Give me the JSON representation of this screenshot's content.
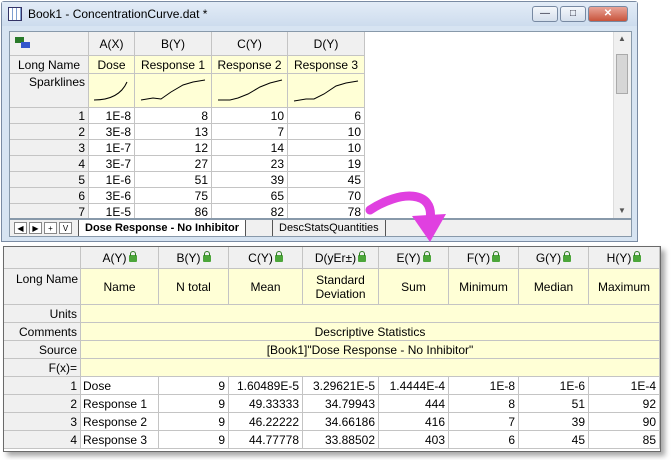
{
  "window": {
    "title": "Book1 - ConcentrationCurve.dat *",
    "min": "—",
    "max": "□",
    "close": "✕"
  },
  "sheet1": {
    "columns": [
      "A(X)",
      "B(Y)",
      "C(Y)",
      "D(Y)"
    ],
    "row_labels": {
      "long_name": "Long Name",
      "sparklines": "Sparklines"
    },
    "long_names": [
      "Dose",
      "Response 1",
      "Response 2",
      "Response 3"
    ],
    "rows": [
      {
        "n": "1",
        "cells": [
          "1E-8",
          "8",
          "10",
          "6"
        ]
      },
      {
        "n": "2",
        "cells": [
          "3E-8",
          "13",
          "7",
          "10"
        ]
      },
      {
        "n": "3",
        "cells": [
          "1E-7",
          "12",
          "14",
          "10"
        ]
      },
      {
        "n": "4",
        "cells": [
          "3E-7",
          "27",
          "23",
          "19"
        ]
      },
      {
        "n": "5",
        "cells": [
          "1E-6",
          "51",
          "39",
          "45"
        ]
      },
      {
        "n": "6",
        "cells": [
          "3E-6",
          "75",
          "65",
          "70"
        ]
      },
      {
        "n": "7",
        "cells": [
          "1E-5",
          "86",
          "82",
          "78"
        ]
      }
    ]
  },
  "tabs": {
    "nav": [
      "◀",
      "▶",
      "+",
      "V"
    ],
    "active": "Dose Response - No Inhibitor",
    "other": "DescStatsQuantities"
  },
  "sheet2": {
    "columns": [
      "A(Y)",
      "B(Y)",
      "C(Y)",
      "D(yEr±)",
      "E(Y)",
      "F(Y)",
      "G(Y)",
      "H(Y)"
    ],
    "row_labels": {
      "long_name": "Long Name",
      "units": "Units",
      "comments": "Comments",
      "source": "Source",
      "fx": "F(x)="
    },
    "long_names": [
      "Name",
      "N total",
      "Mean",
      "Standard Deviation",
      "Sum",
      "Minimum",
      "Median",
      "Maximum"
    ],
    "comments": "Descriptive Statistics",
    "source": "[Book1]\"Dose Response - No Inhibitor\"",
    "rows": [
      {
        "n": "1",
        "cells": [
          "Dose",
          "9",
          "1.60489E-5",
          "3.29621E-5",
          "1.4444E-4",
          "1E-8",
          "1E-6",
          "1E-4"
        ]
      },
      {
        "n": "2",
        "cells": [
          "Response 1",
          "9",
          "49.33333",
          "34.79943",
          "444",
          "8",
          "51",
          "92"
        ]
      },
      {
        "n": "3",
        "cells": [
          "Response 2",
          "9",
          "46.22222",
          "34.66186",
          "416",
          "7",
          "39",
          "90"
        ]
      },
      {
        "n": "4",
        "cells": [
          "Response 3",
          "9",
          "44.77778",
          "33.88502",
          "403",
          "6",
          "45",
          "85"
        ]
      }
    ]
  },
  "colors": {
    "yellow": "#ffffd6",
    "header": "#f0f0f0",
    "arrow": "#e040e0"
  }
}
